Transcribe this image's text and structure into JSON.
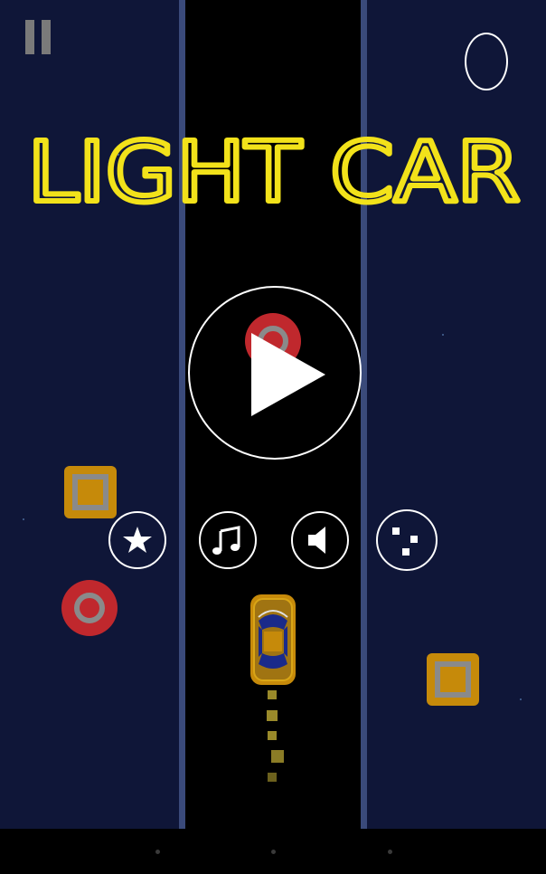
{
  "game": {
    "title": "LIGHT CAR",
    "score": "0"
  },
  "colors": {
    "background": "#0f1638",
    "road": "#000000",
    "divider": "#3a4a7a",
    "title_neon": "#f2e21a",
    "obstacle_square": "#c68a0a",
    "obstacle_ring": "#c0282d",
    "ui_white": "#ffffff"
  },
  "controls": {
    "pause_icon": "pause-icon",
    "play_icon": "play-icon",
    "buttons": [
      {
        "name": "rate-button",
        "icon": "star-icon"
      },
      {
        "name": "music-button",
        "icon": "music-note-icon"
      },
      {
        "name": "sound-button",
        "icon": "speaker-icon"
      },
      {
        "name": "share-button",
        "icon": "dots-icon"
      }
    ]
  }
}
